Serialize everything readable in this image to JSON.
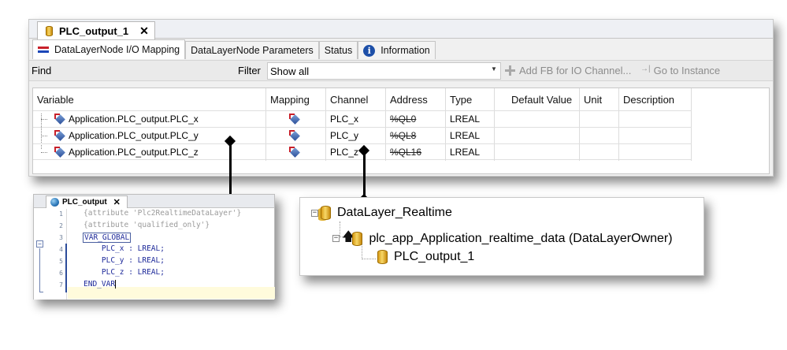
{
  "main": {
    "doc_tab": {
      "title": "PLC_output_1",
      "close": "✕"
    },
    "sub_tabs": [
      {
        "label": "DataLayerNode I/O Mapping"
      },
      {
        "label": "DataLayerNode Parameters"
      },
      {
        "label": "Status"
      },
      {
        "label": "Information"
      }
    ],
    "toolbar": {
      "find_label": "Find",
      "filter_label": "Filter",
      "filter_value": "Show all",
      "add_fb": "Add FB for IO Channel...",
      "go_to_instance": "Go to Instance"
    },
    "grid": {
      "headers": [
        "Variable",
        "Mapping",
        "Channel",
        "Address",
        "Type",
        "Default Value",
        "Unit",
        "Description"
      ],
      "rows": [
        {
          "variable": "Application.PLC_output.PLC_x",
          "channel": "PLC_x",
          "address": "%QL0",
          "type": "LREAL"
        },
        {
          "variable": "Application.PLC_output.PLC_y",
          "channel": "PLC_y",
          "address": "%QL8",
          "type": "LREAL"
        },
        {
          "variable": "Application.PLC_output.PLC_z",
          "channel": "PLC_z",
          "address": "%QL16",
          "type": "LREAL"
        }
      ]
    }
  },
  "editor": {
    "tab_title": "PLC_output",
    "close": "✕",
    "line_numbers": [
      "1",
      "2",
      "3",
      "4",
      "5",
      "6",
      "7"
    ],
    "lines": [
      "{attribute 'Plc2RealtimeDataLayer'}",
      "{attribute 'qualified_only'}",
      "VAR_GLOBAL",
      "    PLC_x : LREAL;",
      "    PLC_y : LREAL;",
      "    PLC_z : LREAL;",
      "END_VAR"
    ]
  },
  "tree": {
    "root": "DataLayer_Realtime",
    "owner": "plc_app_Application_realtime_data (DataLayerOwner)",
    "leaf": "PLC_output_1"
  }
}
